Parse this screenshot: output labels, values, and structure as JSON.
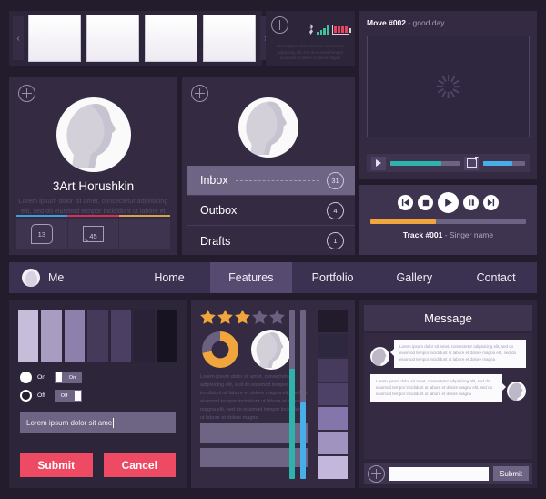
{
  "carousel": {
    "prev_arrow": "‹",
    "next_arrow": "›",
    "thumb_count": 4
  },
  "statusbar": {
    "add_icon": "plus-circle-icon",
    "bluetooth_icon": "bluetooth-icon",
    "signal_icon": "signal-bars-icon",
    "battery_icon": "battery-icon",
    "signal_bars": 4,
    "battery_cells": 4,
    "signal_color": "#3fc39a",
    "battery_color": "#e8435f",
    "text": "Lorem ipsum dolor sit amet, consectetur adipisicing elit, sed do eiusmod tempor incididunt ut labore et dolore magna"
  },
  "profile": {
    "add_icon": "plus-circle-icon",
    "name": "3Art Horushkin",
    "description": "Lorem ipsum dolor sit amet, consectetur adipisicing elit, sed do eiusmod tempor incididunt ut labore et dolore magna",
    "stripe_colors": [
      "#3a9fd8",
      "#cf3355",
      "#d3a24a"
    ],
    "badges": [
      {
        "icon": "comment-bubble-icon",
        "count": "13"
      },
      {
        "icon": "envelope-icon",
        "count": "45"
      }
    ]
  },
  "mailmenu": {
    "add_icon": "plus-circle-icon",
    "items": [
      {
        "label": "Inbox",
        "count": "31",
        "active": true
      },
      {
        "label": "Outbox",
        "count": "4",
        "active": false
      },
      {
        "label": "Drafts",
        "count": "1",
        "active": false
      }
    ]
  },
  "video": {
    "title_bold": "Move #002",
    "title_rest": " - good day",
    "loading_icon": "spinner-icon",
    "play_icon": "play-icon",
    "fullscreen_icon": "fullscreen-icon",
    "progress_percent": 74,
    "progress_color": "#2db3ac",
    "volume_percent": 70,
    "volume_color": "#47aee8"
  },
  "music": {
    "buttons": [
      {
        "icon": "previous-track-icon",
        "glyph": "⏮"
      },
      {
        "icon": "stop-icon",
        "glyph": "■"
      },
      {
        "icon": "play-icon",
        "glyph": "▶"
      },
      {
        "icon": "pause-icon",
        "glyph": "⎉"
      },
      {
        "icon": "next-track-icon",
        "glyph": "⏭"
      }
    ],
    "progress_percent": 42,
    "progress_color": "#f0a63c",
    "title_bold": "Track #001",
    "title_rest": " - Singer name"
  },
  "nav": {
    "avatar_icon": "user-avatar-icon",
    "me_label": "Me",
    "items": [
      {
        "label": "Home",
        "active": false
      },
      {
        "label": "Features",
        "active": true
      },
      {
        "label": "Portfolio",
        "active": false
      },
      {
        "label": "Gallery",
        "active": false
      },
      {
        "label": "Contact",
        "active": false
      }
    ]
  },
  "form": {
    "swatch_colors": [
      "#c6bdda",
      "#a89cc0",
      "#8e80ad",
      "#453a5a",
      "#4b4063",
      "#2a2338",
      "#181321"
    ],
    "radio_on_label": "On",
    "radio_off_label": "Off",
    "switch_on_label": "On",
    "switch_off_label": "Off",
    "input_value": "Lorem ipsum dolor sit ame",
    "submit_label": "Submit",
    "cancel_label": "Cancel",
    "button_color": "#ef4a63"
  },
  "widgets": {
    "rating_filled": 3,
    "rating_total": 5,
    "star_filled_color": "#f0a63c",
    "star_empty_color": "#6a6080",
    "donut_percent": 72,
    "donut_color": "#f0a63c",
    "donut_track_color": "#6a6080",
    "avatar_icon": "user-avatar-icon",
    "text": "Lorem ipsum dolor sit amet, consectetur adipisicing elit, sed do eiusmod tempor incididunt ut labore et dolore magna elit, sed do eiusmod tempor incididunt ut labore et dolore magna elit, sed do eiusmod tempor incididunt ut labore et dolore magna",
    "sliders": [
      {
        "percent": 65,
        "color": "#2db3ac"
      },
      {
        "percent": 45,
        "color": "#47aee8"
      }
    ],
    "chip_colors": [
      "#211b2c",
      "#2e2740",
      "#463b5d",
      "#4d4167",
      "#8476ab",
      "#a093c0",
      "#c3b8dc"
    ]
  },
  "message": {
    "title": "Message",
    "bubbles": [
      {
        "side": "left",
        "avatar_icon": "user-avatar-icon",
        "text": "Lorem ipsum dolor sit amet, consectetur adipisicing elit, sed do eiusmod tempor incididunt ut labore et dolore magna elit, sed do eiusmod tempor incididunt ut labore et dolore magna"
      },
      {
        "side": "right",
        "avatar_icon": "user-avatar-icon",
        "text": "Lorem ipsum dolor sit amet, consectetur adipisicing elit, sed do eiusmod tempor incididunt ut labore et dolore magna elit, sed do eiusmod tempor incididunt ut labore et dolore magna"
      }
    ],
    "add_icon": "plus-circle-icon",
    "input_value": "",
    "submit_label": "Submit"
  }
}
